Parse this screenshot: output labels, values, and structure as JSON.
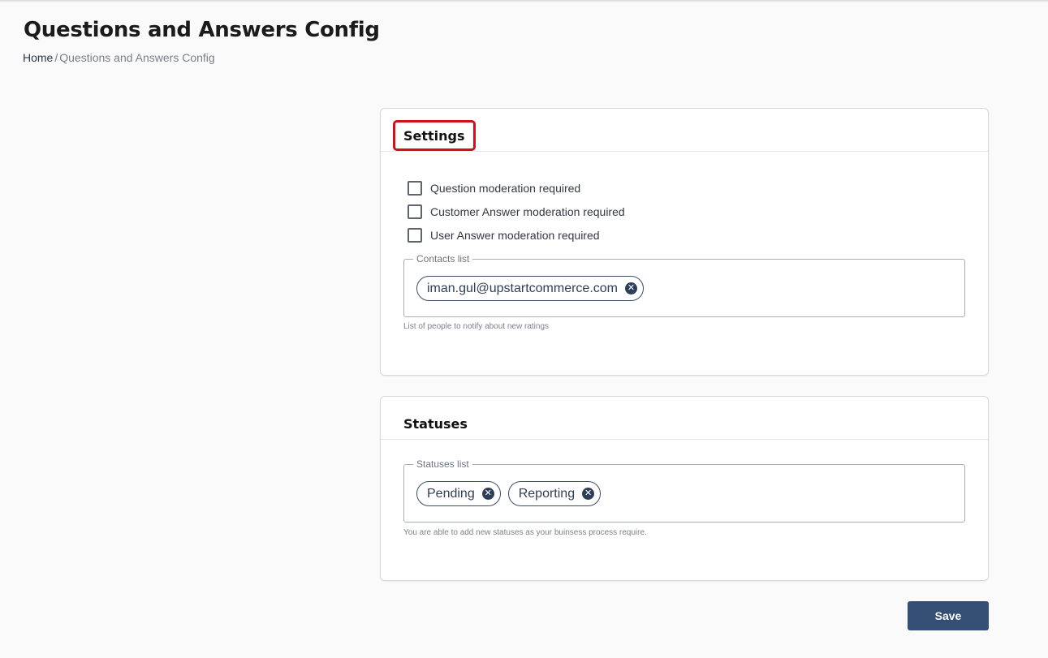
{
  "page": {
    "title": "Questions and Answers Config",
    "breadcrumb": {
      "home": "Home",
      "separator": "/",
      "current": "Questions and Answers Config"
    }
  },
  "settings": {
    "title": "Settings",
    "checkboxes": [
      {
        "label": "Question moderation required",
        "checked": false
      },
      {
        "label": "Customer Answer moderation required",
        "checked": false
      },
      {
        "label": "User Answer moderation required",
        "checked": false
      }
    ],
    "contacts": {
      "legend": "Contacts list",
      "chips": [
        "iman.gul@upstartcommerce.com"
      ],
      "helper": "List of people to notify about new ratings"
    }
  },
  "statuses": {
    "title": "Statuses",
    "list": {
      "legend": "Statuses list",
      "chips": [
        "Pending",
        "Reporting"
      ],
      "helper": "You are able to add new statuses as your buinsess process require."
    }
  },
  "actions": {
    "save_label": "Save"
  },
  "colors": {
    "highlight": "#d0101a",
    "primary": "#344e74",
    "chip_border": "#3b4c68"
  },
  "icons": {
    "chip_remove": "close-circle-icon"
  }
}
